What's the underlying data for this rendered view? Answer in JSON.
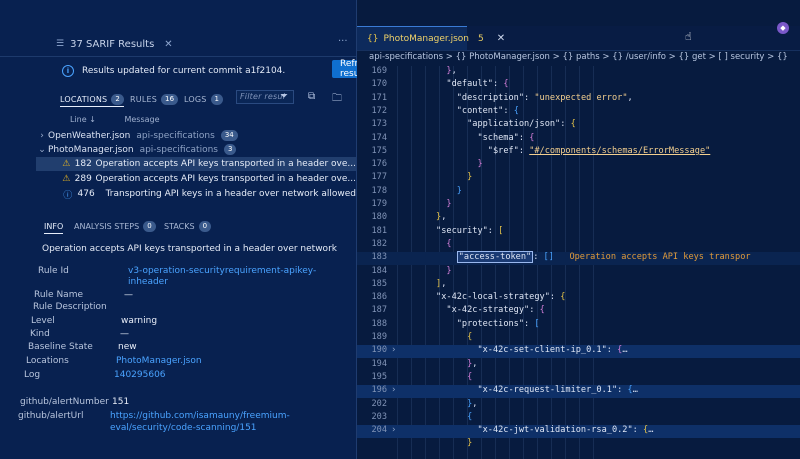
{
  "results_panel": {
    "tab_title": "37 SARIF Results",
    "notice": "Results updated for current commit a1f2104.",
    "refresh_button": "Refresh results",
    "sections": {
      "locations": {
        "label": "LOCATIONS",
        "count": "2"
      },
      "rules": {
        "label": "RULES",
        "count": "16"
      },
      "logs": {
        "label": "LOGS",
        "count": "1"
      },
      "filter_placeholder": "Filter resul"
    },
    "columns": {
      "line": "Line ↓",
      "message": "Message"
    },
    "files": [
      {
        "name": "OpenWeather.json",
        "desc": "api-specifications",
        "count": "34"
      },
      {
        "name": "PhotoManager.json",
        "desc": "api-specifications",
        "count": "3"
      }
    ],
    "results": [
      {
        "line": "182",
        "message": "Operation accepts API keys transported in a header ove..."
      },
      {
        "line": "289",
        "message": "Operation accepts API keys transported in a header ove..."
      },
      {
        "line": "476",
        "message": "Transporting API keys in a header over network allowed"
      }
    ],
    "detail_tabs": {
      "info": "INFO",
      "analysis_steps": {
        "label": "ANALYSIS STEPS",
        "count": "0"
      },
      "stacks": {
        "label": "STACKS",
        "count": "0"
      }
    },
    "description": "Operation accepts API keys transported in a header over network",
    "props": {
      "rule_id_key": "Rule Id",
      "rule_id_line1": "v3-operation-securityrequirement-apikey-",
      "rule_id_line2": "inheader",
      "rule_name_key": "Rule Name",
      "rule_name": "—",
      "rule_desc_key": "Rule Description",
      "level_key": "Level",
      "level": "warning",
      "kind_key": "Kind",
      "kind": "—",
      "baseline_key": "Baseline State",
      "baseline": "new",
      "locations_key": "Locations",
      "locations": "PhotoManager.json",
      "log_key": "Log",
      "log": "140295606",
      "alert_number_key": "github/alertNumber",
      "alert_number": "151",
      "alert_url_key": "github/alertUrl",
      "alert_url_line1": "https://github.com/isamauny/freemium-",
      "alert_url_line2": "eval/security/code-scanning/151"
    }
  },
  "editor": {
    "tab_icon": "{}",
    "tab_name": "PhotoManager.json",
    "tab_problems": "5",
    "breadcrumb": "api-specifications > {} PhotoManager.json > {} paths > {} /user/info > {} get > [ ] security > {}",
    "inline_error": "Operation accepts API keys transpor",
    "lines": [
      {
        "n": "169",
        "code": "        },"
      },
      {
        "n": "170",
        "code": "        \"default\": {"
      },
      {
        "n": "171",
        "code": "          \"description\": \"unexpected error\","
      },
      {
        "n": "172",
        "code": "          \"content\": {"
      },
      {
        "n": "173",
        "code": "            \"application/json\": {"
      },
      {
        "n": "174",
        "code": "              \"schema\": {"
      },
      {
        "n": "175",
        "code": "                \"$ref\": \"#/components/schemas/ErrorMessage\""
      },
      {
        "n": "176",
        "code": "              }"
      },
      {
        "n": "177",
        "code": "            }"
      },
      {
        "n": "178",
        "code": "          }"
      },
      {
        "n": "179",
        "code": "        }"
      },
      {
        "n": "180",
        "code": "      },"
      },
      {
        "n": "181",
        "code": "      \"security\": ["
      },
      {
        "n": "182",
        "code": "        {"
      },
      {
        "n": "183",
        "code": "          \"access-token\": []"
      },
      {
        "n": "184",
        "code": "        }"
      },
      {
        "n": "185",
        "code": "      ],"
      },
      {
        "n": "186",
        "code": "      \"x-42c-local-strategy\": {"
      },
      {
        "n": "187",
        "code": "        \"x-42c-strategy\": {"
      },
      {
        "n": "188",
        "code": "          \"protections\": ["
      },
      {
        "n": "189",
        "code": "            {"
      },
      {
        "n": "190",
        "code": "              \"x-42c-set-client-ip_0.1\": {…"
      },
      {
        "n": "194",
        "code": "            },"
      },
      {
        "n": "195",
        "code": "            {"
      },
      {
        "n": "196",
        "code": "              \"x-42c-request-limiter_0.1\": {…"
      },
      {
        "n": "202",
        "code": "            },"
      },
      {
        "n": "203",
        "code": "            {"
      },
      {
        "n": "204",
        "code": "              \"x-42c-jwt-validation-rsa_0.2\": {…"
      },
      {
        "n": "",
        "code": "            }"
      }
    ]
  },
  "colors": {
    "background": "#071b3f",
    "panel": "#082150",
    "accent": "#0f6fcf",
    "warning": "#e6b422",
    "info": "#4aa3ff"
  }
}
